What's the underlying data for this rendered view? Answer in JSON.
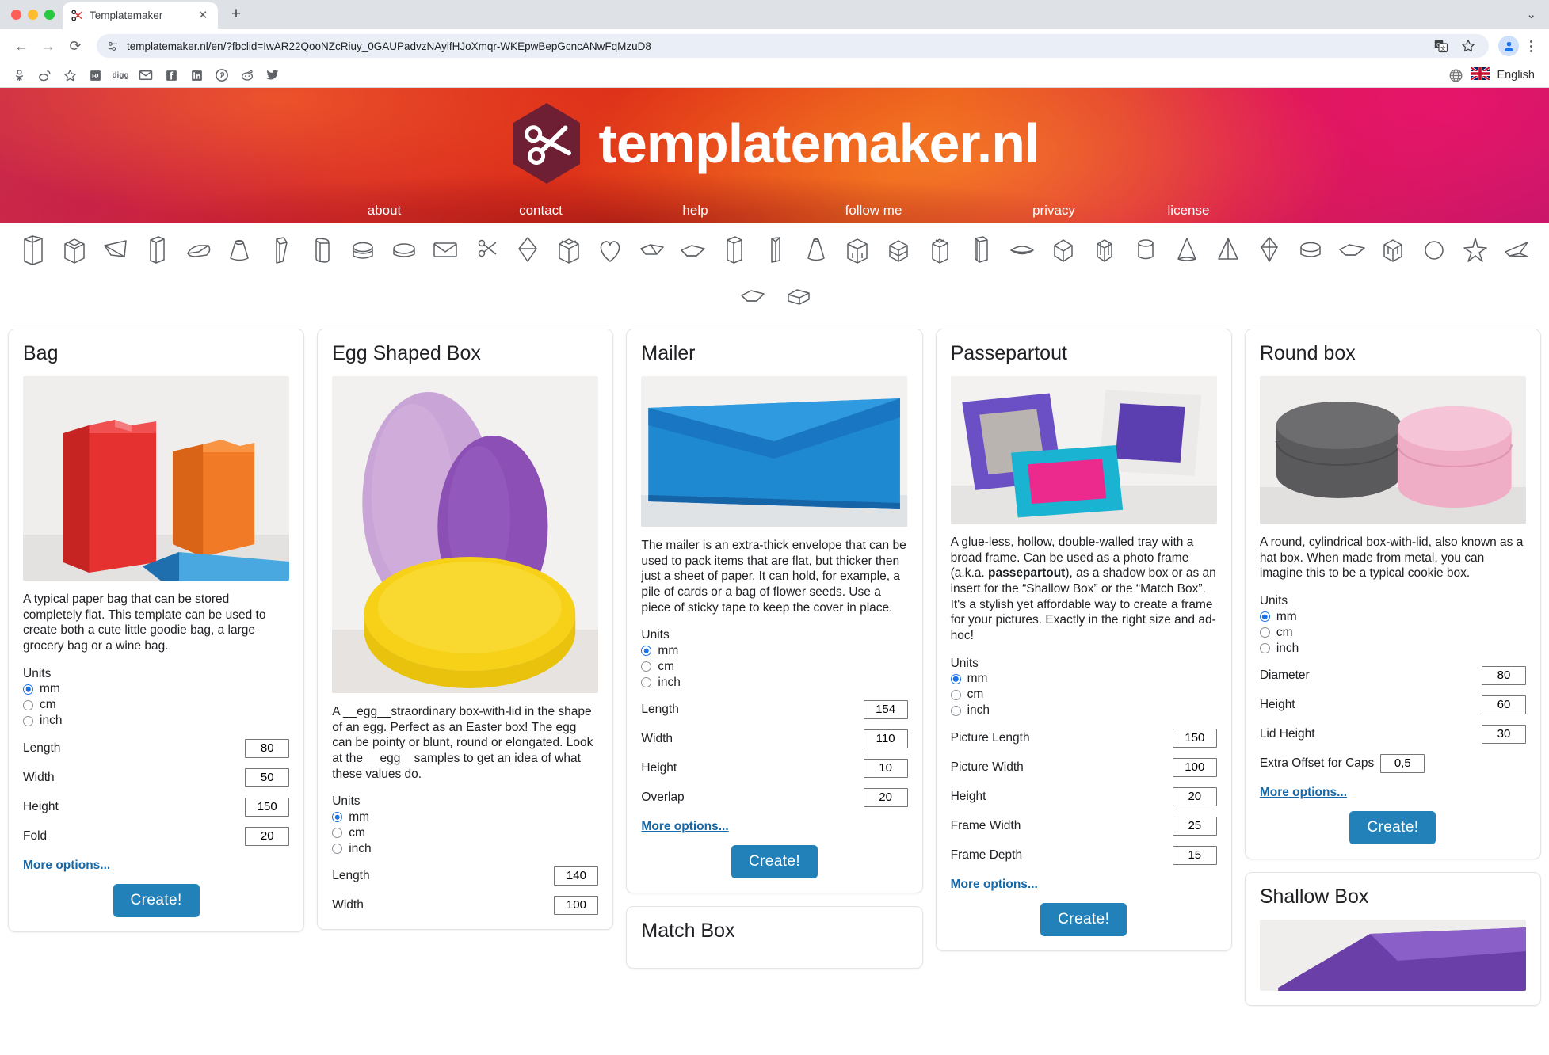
{
  "browser": {
    "tab": {
      "title": "Templatemaker",
      "favicon": "scissors-icon",
      "close": "✕"
    },
    "newtab_label": "+",
    "window_chevron": "⌄",
    "nav": {
      "back": "←",
      "forward": "→",
      "reload": "⟳"
    },
    "omnibox": {
      "url": "templatemaker.nl/en/?fbclid=IwAR22QooNZcRiuy_0GAUPadvzNAylfHJoXmqr-WKEpwBepGcncANwFqMzuD8",
      "site_icon": "page-info-icon"
    },
    "toolbar_right": [
      "translate-icon",
      "bookmark-star-icon",
      "profile-avatar",
      "kebab-menu"
    ],
    "bookmarks": [
      "odnoklassniki-icon",
      "weibo-icon",
      "favorites-star-icon",
      "hatena-icon",
      "digg-icon",
      "email-icon",
      "facebook-icon",
      "linkedin-icon",
      "pinterest-icon",
      "reddit-icon",
      "twitter-icon"
    ],
    "language": {
      "globe": "globe-icon",
      "flag": "uk-flag-icon",
      "label": "English"
    }
  },
  "site": {
    "brand": "templatemaker.nl",
    "logo": "scissors-hexagon-logo",
    "nav": [
      {
        "label": "about",
        "cls": "nav-about"
      },
      {
        "label": "contact",
        "cls": "nav-contact"
      },
      {
        "label": "help",
        "cls": "nav-help"
      },
      {
        "label": "follow me",
        "cls": "nav-follow"
      },
      {
        "label": "privacy",
        "cls": "nav-privacy"
      },
      {
        "label": "license",
        "cls": "nav-license"
      }
    ],
    "shape_icons_row1": [
      "bag-shape",
      "cube-box-shape",
      "wedge-shape",
      "flat-box-shape",
      "pillow-shape",
      "tapered-cup-shape",
      "pen-sleeve-shape",
      "rounded-box-shape",
      "round-box-shape",
      "oval-box-shape",
      "envelope-shape",
      "scissors-shape",
      "diamond-shape",
      "open-cube-shape",
      "heart-shape",
      "tray-shape",
      "shallow-tray-shape",
      "tall-box-shape",
      "triangle-sleeve-shape",
      "cone-shape",
      "crate-shape",
      "hexbox-shape",
      "milk-carton-shape",
      "book-box-shape",
      "lens-shape",
      "pyramid-box-shape",
      "hex-prism-shape",
      "cylinder-shape",
      "cone-tall-shape",
      "tetra-shape",
      "gem-shape",
      "round-flat-shape",
      "long-tray-shape",
      "puzzle-shape",
      "sphere-shape",
      "star-shape",
      "plane-shape"
    ],
    "shape_icons_row2": [
      "shallow-box-shape",
      "match-box-shape"
    ]
  },
  "columns": [
    {
      "cards": [
        {
          "title": "Bag",
          "photo": "paper-bags-photo",
          "description": "A typical paper bag that can be stored completely flat. This template can be used to create both a cute little goodie bag, a large grocery bag or a wine bag.",
          "units_label": "Units",
          "units": [
            {
              "label": "mm",
              "selected": true
            },
            {
              "label": "cm",
              "selected": false
            },
            {
              "label": "inch",
              "selected": false
            }
          ],
          "fields": [
            {
              "label": "Length",
              "value": "80"
            },
            {
              "label": "Width",
              "value": "50"
            },
            {
              "label": "Height",
              "value": "150"
            },
            {
              "label": "Fold",
              "value": "20"
            }
          ],
          "more_label": "More options...",
          "create_label": "Create!"
        }
      ]
    },
    {
      "cards": [
        {
          "title": "Egg Shaped Box",
          "photo": "egg-boxes-photo",
          "description": "A __egg__straordinary box-with-lid in the shape of an egg. Perfect as an Easter box! The egg can be pointy or blunt, round or elongated. Look at the __egg__samples to get an idea of what these values do.",
          "units_label": "Units",
          "units": [
            {
              "label": "mm",
              "selected": true
            },
            {
              "label": "cm",
              "selected": false
            },
            {
              "label": "inch",
              "selected": false
            }
          ],
          "fields": [
            {
              "label": "Length",
              "value": "140"
            },
            {
              "label": "Width",
              "value": "100"
            }
          ],
          "more_label": "",
          "create_label": ""
        }
      ]
    },
    {
      "cards": [
        {
          "title": "Mailer",
          "photo": "blue-mailer-photo",
          "description": "The mailer is an extra-thick envelope that can be used to pack items that are flat, but thicker then just a sheet of paper. It can hold, for example, a pile of cards or a bag of flower seeds. Use a piece of sticky tape to keep the cover in place.",
          "units_label": "Units",
          "units": [
            {
              "label": "mm",
              "selected": true
            },
            {
              "label": "cm",
              "selected": false
            },
            {
              "label": "inch",
              "selected": false
            }
          ],
          "fields": [
            {
              "label": "Length",
              "value": "154"
            },
            {
              "label": "Width",
              "value": "110"
            },
            {
              "label": "Height",
              "value": "10"
            },
            {
              "label": "Overlap",
              "value": "20"
            }
          ],
          "more_label": "More options...",
          "create_label": "Create!"
        },
        {
          "title": "Match Box",
          "partial": true
        }
      ]
    },
    {
      "cards": [
        {
          "title": "Passepartout",
          "photo": "photo-frames-photo",
          "description_html": "A glue-less, hollow, double-walled tray with a broad frame. Can be used as a photo frame (a.k.a. <b>passepartout</b>), as a shadow box or as an insert for the “Shallow Box” or the “Match Box”. It's a stylish yet affordable way to create a frame for your pictures. Exactly in the right size and ad-hoc!",
          "units_label": "Units",
          "units": [
            {
              "label": "mm",
              "selected": true
            },
            {
              "label": "cm",
              "selected": false
            },
            {
              "label": "inch",
              "selected": false
            }
          ],
          "fields": [
            {
              "label": "Picture Length",
              "value": "150"
            },
            {
              "label": "Picture Width",
              "value": "100"
            },
            {
              "label": "Height",
              "value": "20"
            },
            {
              "label": "Frame Width",
              "value": "25"
            },
            {
              "label": "Frame Depth",
              "value": "15"
            }
          ],
          "more_label": "More options...",
          "create_label": "Create!"
        }
      ]
    },
    {
      "cards": [
        {
          "title": "Round box",
          "photo": "round-hat-boxes-photo",
          "description": "A round, cylindrical box-with-lid, also known as a hat box. When made from metal, you can imagine this to be a typical cookie box.",
          "units_label": "Units",
          "units": [
            {
              "label": "mm",
              "selected": true
            },
            {
              "label": "cm",
              "selected": false
            },
            {
              "label": "inch",
              "selected": false
            }
          ],
          "fields": [
            {
              "label": "Diameter",
              "value": "80"
            },
            {
              "label": "Height",
              "value": "60"
            },
            {
              "label": "Lid Height",
              "value": "30"
            },
            {
              "label": "Extra Offset for Caps",
              "value": "0,5"
            }
          ],
          "more_label": "More options...",
          "create_label": "Create!"
        },
        {
          "title": "Shallow Box",
          "partial": true,
          "photo": "shallow-box-photo"
        }
      ]
    }
  ],
  "colors": {
    "accent_blue": "#2281b8",
    "link_blue": "#1668a8",
    "radio_blue": "#1a73e8",
    "hero_red": "#d42020",
    "hero_magenta": "#c0166a",
    "logo_maroon": "#6e1f33"
  }
}
